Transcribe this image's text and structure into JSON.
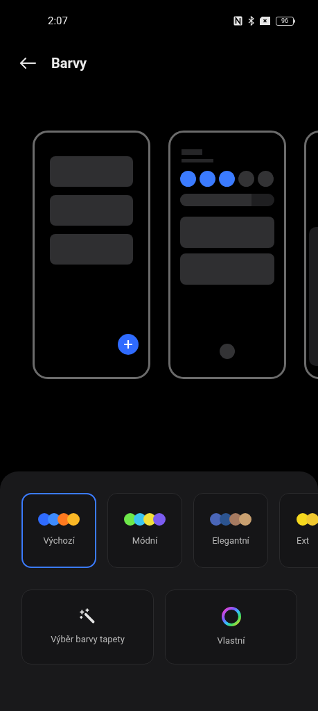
{
  "status_bar": {
    "time": "2:07",
    "battery": "96"
  },
  "header": {
    "title": "Barvy"
  },
  "preview_slider": {
    "level": 0.76
  },
  "palettes": [
    {
      "label": "Výchozí",
      "selected": true,
      "swatches": [
        {
          "color": "#2f6bff"
        },
        {
          "color": "#3d8bff"
        },
        {
          "color": "#ff7a1f"
        },
        {
          "color": "#fbb826"
        }
      ]
    },
    {
      "label": "Módní",
      "selected": false,
      "swatches": [
        {
          "color": "#6ee84a"
        },
        {
          "color": "#3cc4f0"
        },
        {
          "color": "#f1e03a"
        },
        {
          "color": "#7b5cf0"
        }
      ]
    },
    {
      "label": "Elegantní",
      "selected": false,
      "swatches": [
        {
          "color": "#4a66b8"
        },
        {
          "color": "#2c5490"
        },
        {
          "color": "#a67a60"
        },
        {
          "color": "#c9a070"
        }
      ]
    },
    {
      "label": "Ext",
      "selected": false,
      "swatches": [
        {
          "color": "#f5d81e"
        },
        {
          "color": "#f0c830"
        }
      ]
    }
  ],
  "actions": [
    {
      "kind": "wand",
      "label": "Výběr barvy tapety"
    },
    {
      "kind": "ring",
      "label": "Vlastní"
    }
  ]
}
